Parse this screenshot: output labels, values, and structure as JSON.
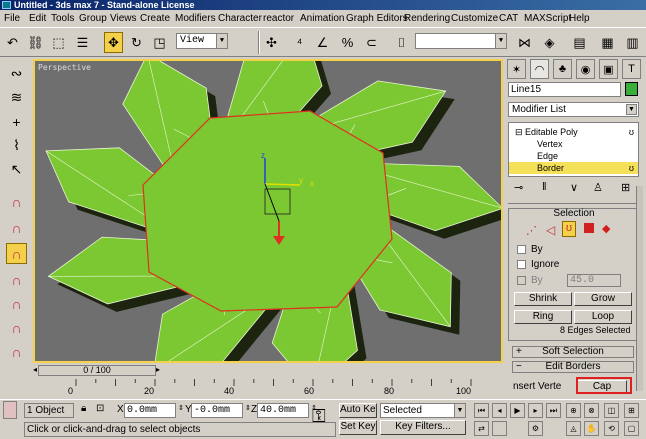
{
  "window": {
    "title": "Untitled - 3ds max 7 - Stand-alone License"
  },
  "menu": [
    "File",
    "Edit",
    "Tools",
    "Group",
    "Views",
    "Create",
    "Modifiers",
    "Character",
    "reactor",
    "Animation",
    "Graph Editors",
    "Rendering",
    "Customize",
    "CAT",
    "MAXScript",
    "Help"
  ],
  "toolbar": {
    "refcoord": "View",
    "named_selection": ""
  },
  "viewport": {
    "label": "Perspective"
  },
  "gizmo": {
    "x": "x",
    "y": "y",
    "z": "z"
  },
  "time": {
    "slider": "0 / 100",
    "ticks": [
      "0",
      "20",
      "40",
      "60",
      "80",
      "100"
    ]
  },
  "panel": {
    "object_name": "Line15",
    "modifier_list": "Modifier List",
    "stack": [
      "Editable Poly",
      "Vertex",
      "Edge",
      "Border"
    ],
    "selection_title": "Selection",
    "by_vertex": "By",
    "ignore_backfacing": "Ignore",
    "by_angle": "By",
    "angle_value": "45.0",
    "shrink": "Shrink",
    "grow": "Grow",
    "ring": "Ring",
    "loop": "Loop",
    "status": "8 Edges Selected",
    "soft_selection": "Soft Selection",
    "edit_borders": "Edit Borders",
    "insert_vertex": "nsert Verte",
    "cap": "Cap",
    "accent": "#f5d04a",
    "highlight_box": "#e02020"
  },
  "status": {
    "selection_count": "1 Object",
    "x_label": "X",
    "x_value": "0.0mm",
    "y_label": "Y",
    "y_value": "-0.0mm",
    "z_label": "Z",
    "z_value": "40.0mm",
    "auto_key": "Auto Key",
    "set_key": "Set Key",
    "key_mode": "Selected",
    "key_filters": "Key Filters...",
    "prompt": "Click or click-and-drag to select objects"
  },
  "colors": {
    "mesh": "#7cc832",
    "edge": "#e8f5d0",
    "selected_edge": "#e03020",
    "shadow": "#1c2410",
    "viewport_bg": "#6f6f6f"
  }
}
